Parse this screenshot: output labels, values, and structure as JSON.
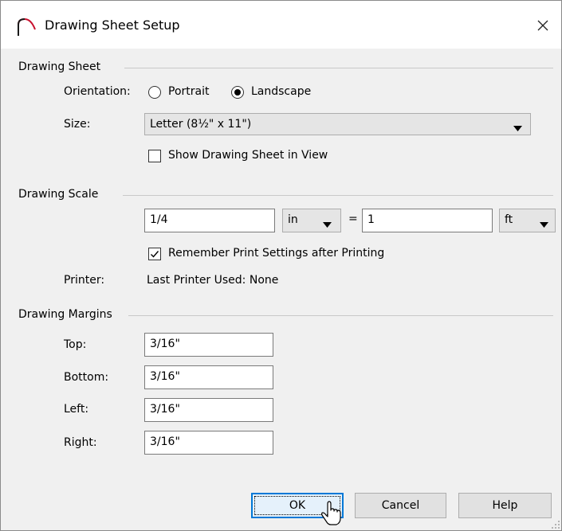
{
  "window": {
    "title": "Drawing Sheet Setup",
    "icon": "arc-icon",
    "close_icon": "close-icon"
  },
  "drawing_sheet": {
    "label": "Drawing Sheet",
    "orientation_label": "Orientation:",
    "orientation_options": [
      "Portrait",
      "Landscape"
    ],
    "orientation_selected": "Landscape",
    "size_label": "Size:",
    "size_value": "Letter  (8½\" x 11\")",
    "show_sheet_label": "Show Drawing Sheet in View",
    "show_sheet_checked": false
  },
  "drawing_scale": {
    "label": "Drawing Scale",
    "left_value": "1/4",
    "left_unit": "in",
    "equals": "=",
    "right_value": "1",
    "right_unit": "ft",
    "remember_label": "Remember Print Settings after Printing",
    "remember_checked": true,
    "printer_label": "Printer:",
    "printer_value": "Last Printer Used: None"
  },
  "drawing_margins": {
    "label": "Drawing Margins",
    "top_label": "Top:",
    "top_value": "3/16\"",
    "bottom_label": "Bottom:",
    "bottom_value": "3/16\"",
    "left_label": "Left:",
    "left_value": "3/16\"",
    "right_label": "Right:",
    "right_value": "3/16\""
  },
  "buttons": {
    "ok": "OK",
    "cancel": "Cancel",
    "help": "Help"
  },
  "colors": {
    "accent": "#0078d7",
    "icon_red": "#c8102e"
  }
}
